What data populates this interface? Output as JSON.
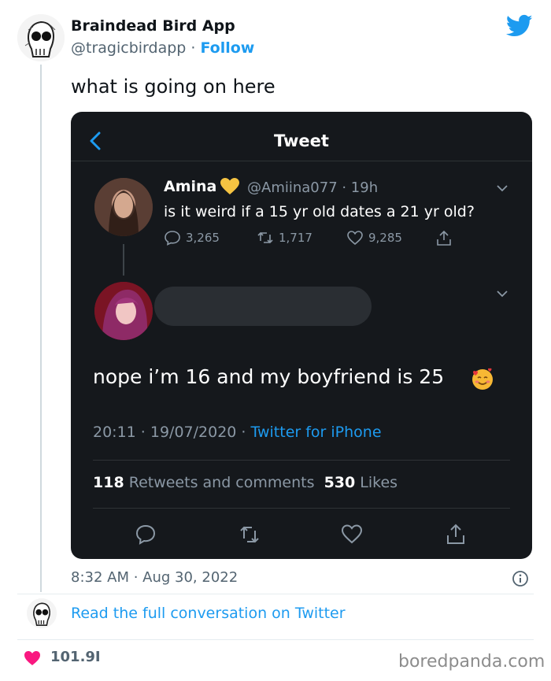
{
  "header": {
    "display_name": "Braindead Bird App",
    "handle": "@tragicbirdapp",
    "separator": " · ",
    "follow_label": "Follow"
  },
  "tweet": {
    "text": "what is going on here"
  },
  "embedded": {
    "title": "Tweet",
    "original": {
      "name": "Amina",
      "handle_time": "@Amiina077 · 19h",
      "text": "is it weird if a 15 yr old dates a 21 yr old?",
      "replies": "3,265",
      "retweets": "1,717",
      "likes": "9,285"
    },
    "reply": {
      "text": "nope i’m 16 and my boyfriend is 25",
      "meta_time": "20:11 · 19/07/2020 · ",
      "meta_via": "Twitter for iPhone",
      "retweets_count": "118",
      "retweets_label": "Retweets and comments",
      "likes_count": "530",
      "likes_label": "Likes"
    }
  },
  "footer": {
    "timestamp": "8:32 AM · Aug 30, 2022",
    "read_more": "Read the full conversation on Twitter",
    "like_count": "101.9I",
    "watermark": "boredpanda.com"
  },
  "colors": {
    "twitter_blue": "#1d9bf0",
    "dark_bg": "#15181c",
    "like_pink": "#f91880"
  }
}
